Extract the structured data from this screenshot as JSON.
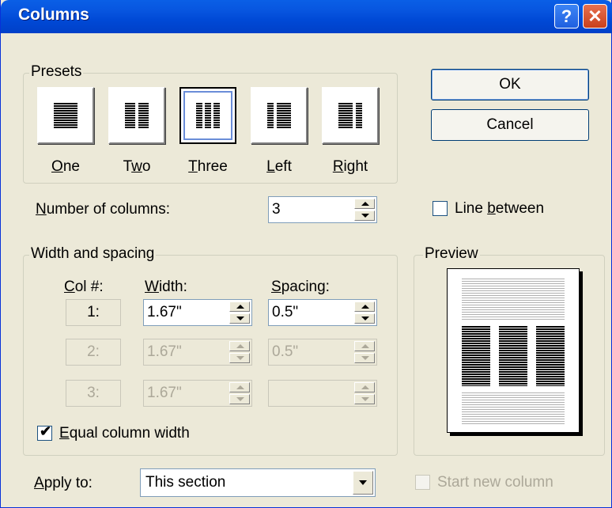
{
  "window": {
    "title": "Columns",
    "help_glyph": "?",
    "close_glyph": "✕"
  },
  "presets": {
    "legend": "Presets",
    "items": [
      {
        "label": "One",
        "key": "O",
        "rest": "ne",
        "selected": false
      },
      {
        "label": "Two",
        "key": "w",
        "pre": "T",
        "rest": "o",
        "selected": false
      },
      {
        "label": "Three",
        "key": "T",
        "rest": "hree",
        "selected": true
      },
      {
        "label": "Left",
        "key": "L",
        "rest": "eft",
        "selected": false
      },
      {
        "label": "Right",
        "key": "R",
        "rest": "ight",
        "selected": false
      }
    ]
  },
  "number_of_columns": {
    "label_key": "N",
    "label_rest": "umber of columns:",
    "value": "3"
  },
  "line_between": {
    "label_pre": "Line ",
    "label_key": "b",
    "label_rest": "etween",
    "checked": false
  },
  "width_spacing": {
    "legend": "Width and spacing",
    "col_header_key": "C",
    "col_header_rest": "ol #:",
    "width_header_key": "W",
    "width_header_rest": "idth:",
    "spacing_header_key": "S",
    "spacing_header_rest": "pacing:",
    "rows": [
      {
        "col": "1:",
        "width": "1.67\"",
        "spacing": "0.5\"",
        "enabled": true
      },
      {
        "col": "2:",
        "width": "1.67\"",
        "spacing": "0.5\"",
        "enabled": false
      },
      {
        "col": "3:",
        "width": "1.67\"",
        "spacing": "",
        "enabled": false
      }
    ]
  },
  "equal_width": {
    "label_key": "E",
    "label_rest": "qual column width",
    "checked": true,
    "check_glyph": "✔"
  },
  "apply_to": {
    "label_key": "A",
    "label_rest": "pply to:",
    "value": "This section"
  },
  "start_new_column": {
    "label": "Start new column",
    "checked": false,
    "enabled": false
  },
  "buttons": {
    "ok": "OK",
    "cancel": "Cancel"
  },
  "preview": {
    "legend": "Preview",
    "columns": 3
  }
}
